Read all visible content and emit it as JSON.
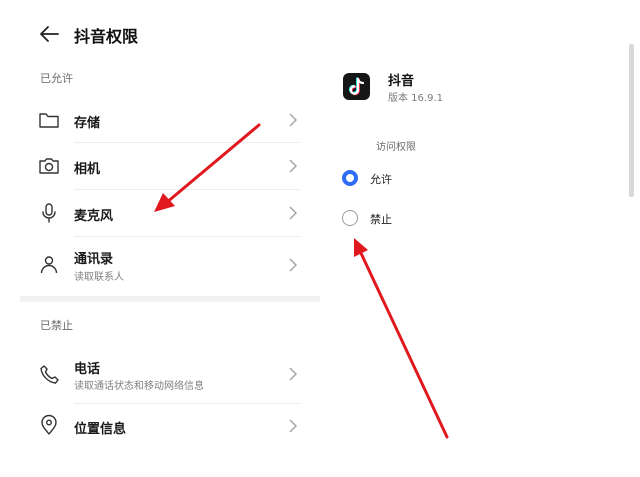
{
  "header": {
    "title": "抖音权限"
  },
  "allowed_section": {
    "label": "已允许",
    "items": [
      {
        "title": "存储",
        "icon": "folder-icon"
      },
      {
        "title": "相机",
        "icon": "camera-icon"
      },
      {
        "title": "麦克风",
        "icon": "microphone-icon"
      },
      {
        "title": "通讯录",
        "subtitle": "读取联系人",
        "icon": "contacts-icon"
      }
    ]
  },
  "denied_section": {
    "label": "已禁止",
    "items": [
      {
        "title": "电话",
        "subtitle": "读取通话状态和移动网络信息",
        "icon": "phone-icon"
      },
      {
        "title": "位置信息",
        "icon": "location-icon"
      }
    ]
  },
  "app_info": {
    "name": "抖音",
    "version": "版本 16.9.1",
    "icon": "tiktok-logo-icon"
  },
  "access": {
    "title": "访问权限",
    "options": [
      {
        "label": "允许",
        "selected": true
      },
      {
        "label": "禁止",
        "selected": false
      }
    ]
  },
  "colors": {
    "accent": "#2f6df5",
    "arrow": "#e0191f"
  }
}
